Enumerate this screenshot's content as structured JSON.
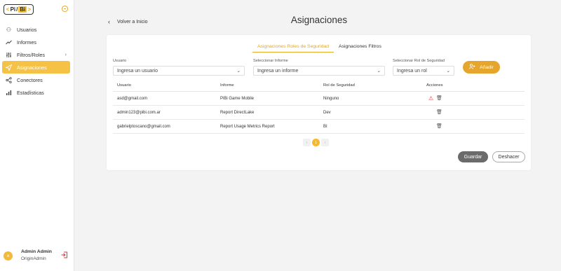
{
  "logo": {
    "left": "<",
    "pi": "Pi",
    "sep": "/",
    "bi": "Bi",
    "right": ">"
  },
  "sidebar": {
    "items": [
      {
        "label": "Usuarios",
        "icon": "users-icon"
      },
      {
        "label": "Informes",
        "icon": "trend-icon"
      },
      {
        "label": "Filtros/Roles",
        "icon": "sliders-icon"
      },
      {
        "label": "Asignaciones",
        "icon": "send-icon"
      },
      {
        "label": "Conectores",
        "icon": "share-icon"
      },
      {
        "label": "Estadísticas",
        "icon": "bar-chart-icon"
      }
    ],
    "user": {
      "initial": "A",
      "name": "Admin Admin",
      "role": "OriginAdmin"
    }
  },
  "header": {
    "back_label": "Volver a Inicio",
    "title": "Asignaciones"
  },
  "tabs": [
    {
      "label": "Asignaciones Roles de Seguridad",
      "active": true
    },
    {
      "label": "Asignaciones Filtros",
      "active": false
    }
  ],
  "form": {
    "usuario_label": "Usuario",
    "usuario_placeholder": "Ingresa un usuario",
    "informe_label": "Seleccionar Informe",
    "informe_placeholder": "Ingresa un informe",
    "rol_label": "Seleccionar Rol de Seguridad",
    "rol_placeholder": "Ingresa un rol",
    "add_label": "Añadir"
  },
  "table": {
    "headers": [
      "Usuario",
      "Informe",
      "Rol de Seguridad",
      "Acciones"
    ],
    "rows": [
      {
        "usuario": "asd@gmail.com",
        "informe": "PiBi Game Mobile",
        "rol": "Ninguno"
      },
      {
        "usuario": "admin123@pibi.com.ar",
        "informe": "Report DirectLake",
        "rol": "Dev"
      },
      {
        "usuario": "gabrielptoscano@gmail.com",
        "informe": "Report Usage Metrics Report",
        "rol": "BI"
      }
    ]
  },
  "pagination": {
    "prev": "‹",
    "current": "1",
    "next": "›"
  },
  "actions": {
    "save_label": "Guardar",
    "undo_label": "Deshacer"
  },
  "colors": {
    "accent": "#e5a823",
    "active_nav": "#f5c246",
    "warning": "#e03c3c",
    "logout": "#e0393e"
  }
}
